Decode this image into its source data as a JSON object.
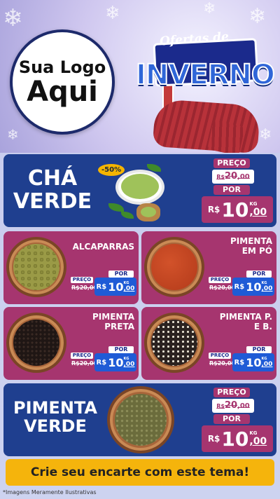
{
  "header": {
    "logo_line1": "Sua Logo",
    "logo_line2": "Aqui",
    "promo_top": "Ofertas de",
    "promo_main": "INVERNO"
  },
  "colors": {
    "blue": "#1f3f8f",
    "pink": "#a6356f",
    "navy": "#1b2a8c",
    "yellow": "#f5b40c"
  },
  "featured_top": {
    "title_line1": "CHÁ",
    "title_line2": "VERDE",
    "discount": "-50%",
    "preco_label": "PREÇO",
    "old_price_currency": "R$",
    "old_price_int": "20",
    "old_price_dec": ",00",
    "por_label": "POR",
    "currency": "R$",
    "price_int": "10",
    "price_dec": ",00",
    "unit": "KG"
  },
  "products": [
    {
      "title_line1": "ALCAPARRAS",
      "title_line2": "",
      "preco_label": "PREÇO",
      "old_price": "R$20,00",
      "por_label": "POR",
      "currency": "R$",
      "price_int": "10",
      "price_dec": ",00",
      "unit": "KG"
    },
    {
      "title_line1": "PIMENTA",
      "title_line2": "EM PÓ",
      "preco_label": "PREÇO",
      "old_price": "R$20,00",
      "por_label": "POR",
      "currency": "R$",
      "price_int": "10",
      "price_dec": ",00",
      "unit": "KG"
    },
    {
      "title_line1": "PIMENTA",
      "title_line2": "PRETA",
      "preco_label": "PREÇO",
      "old_price": "R$20,00",
      "por_label": "POR",
      "currency": "R$",
      "price_int": "10",
      "price_dec": ",00",
      "unit": "KG"
    },
    {
      "title_line1": "PIMENTA P.",
      "title_line2": "E B.",
      "preco_label": "PREÇO",
      "old_price": "R$20,00",
      "por_label": "POR",
      "currency": "R$",
      "price_int": "10",
      "price_dec": ",00",
      "unit": "KG"
    }
  ],
  "featured_bottom": {
    "title_line1": "PIMENTA",
    "title_line2": "VERDE",
    "preco_label": "PREÇO",
    "old_price_currency": "R$",
    "old_price_int": "20",
    "old_price_dec": ",00",
    "por_label": "POR",
    "currency": "R$",
    "price_int": "10",
    "price_dec": ",00",
    "unit": "KG"
  },
  "cta": "Crie seu encarte com este tema!",
  "footer_note": "*Imagens Meramente Ilustrativas"
}
